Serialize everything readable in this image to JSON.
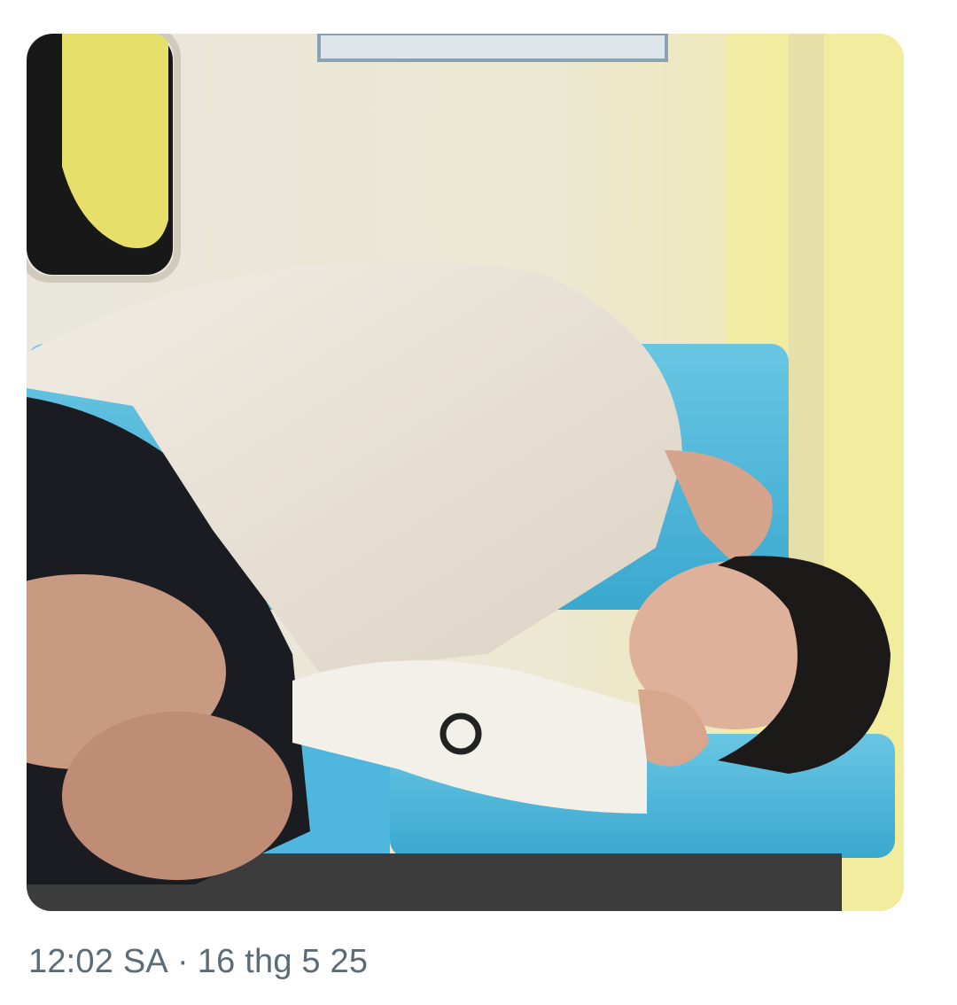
{
  "post": {
    "media": {
      "icon": "photo-icon"
    },
    "time": "12:02 SA",
    "separator": "·",
    "date": "16 thg 5 25"
  }
}
